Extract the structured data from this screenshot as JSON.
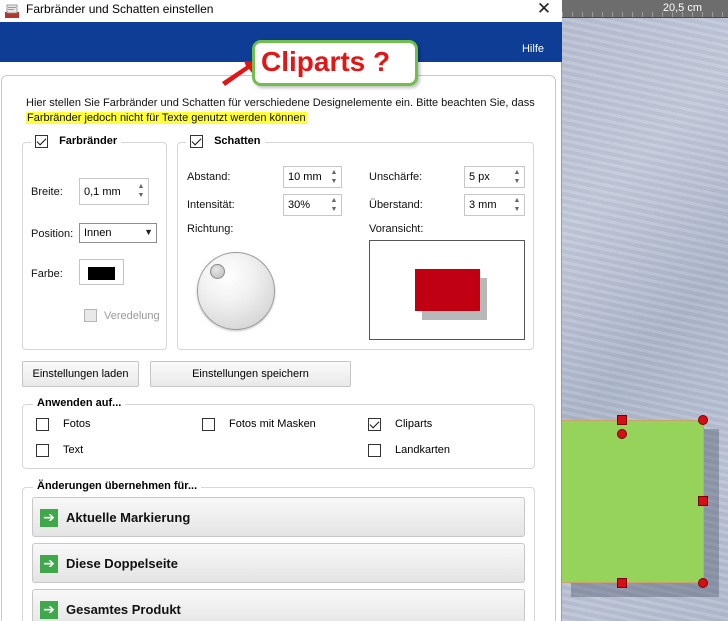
{
  "window": {
    "title": "Farbränder und Schatten einstellen",
    "close": "✕",
    "help": "Hilfe"
  },
  "ruler": {
    "value": "20,5 cm"
  },
  "callout": {
    "text": "Cliparts ?"
  },
  "intro": {
    "line1": "Hier stellen Sie Farbränder und Schatten für verschiedene Designelemente ein. Bitte beachten Sie, dass",
    "line2": "Farbränder jedoch nicht für Texte genutzt werden können"
  },
  "border_group": {
    "title": "Farbränder",
    "checked": true,
    "width_label": "Breite:",
    "width_value": "0,1 mm",
    "position_label": "Position:",
    "position_value": "Innen",
    "color_label": "Farbe:",
    "color": "#000000",
    "refine_label": "Veredelung"
  },
  "shadow_group": {
    "title": "Schatten",
    "checked": true,
    "distance_label": "Abstand:",
    "distance_value": "10 mm",
    "intensity_label": "Intensität:",
    "intensity_value": "30%",
    "direction_label": "Richtung:",
    "blur_label": "Unschärfe:",
    "blur_value": "5 px",
    "overhang_label": "Überstand:",
    "overhang_value": "3 mm",
    "preview_label": "Voransicht:",
    "preview_color": "#c00012"
  },
  "buttons": {
    "load": "Einstellungen laden",
    "save": "Einstellungen speichern"
  },
  "apply": {
    "title": "Anwenden auf...",
    "items": [
      {
        "label": "Fotos",
        "checked": false
      },
      {
        "label": "Fotos mit Masken",
        "checked": false
      },
      {
        "label": "Cliparts",
        "checked": true
      },
      {
        "label": "Text",
        "checked": false
      },
      {
        "label": "Landkarten",
        "checked": false
      }
    ]
  },
  "changes": {
    "title": "Änderungen übernehmen für...",
    "actions": [
      "Aktuelle Markierung",
      "Diese Doppelseite",
      "Gesamtes Produkt"
    ]
  }
}
